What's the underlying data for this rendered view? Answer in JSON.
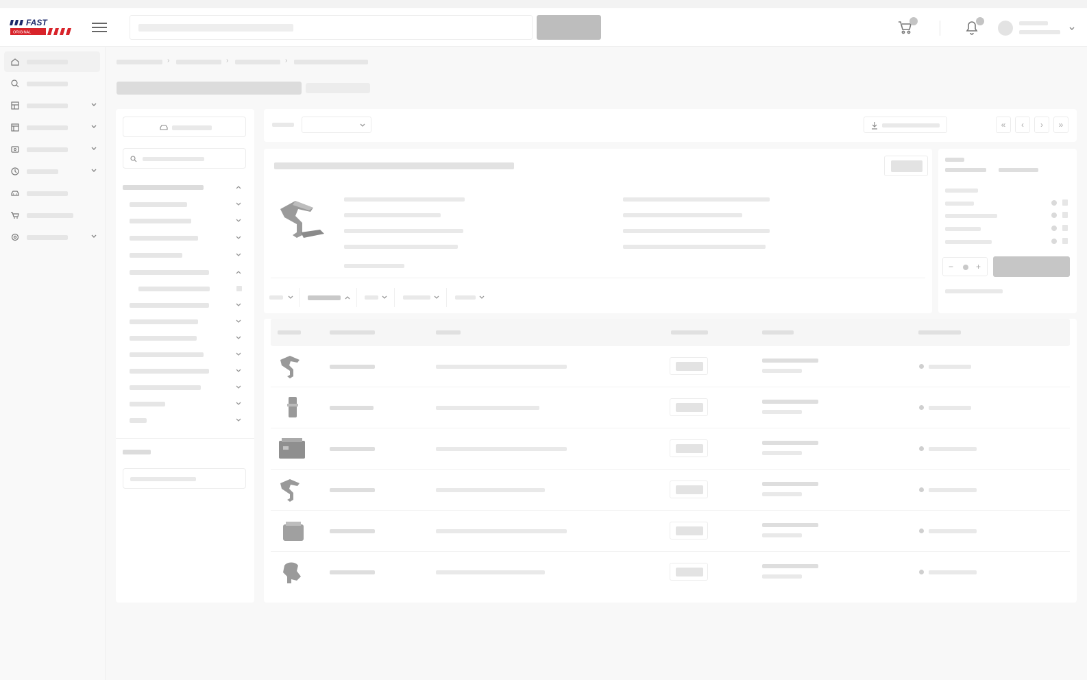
{
  "header": {
    "logo": {
      "wordmark": "FAST",
      "tagline": "ORIGINAL",
      "colors": {
        "blue": "#1d2a6b",
        "red": "#d8232a"
      }
    },
    "search_icon": "none",
    "icons": [
      "menu-icon",
      "cart-icon",
      "bell-icon",
      "avatar"
    ]
  },
  "sidebar": {
    "icons": [
      "home-icon",
      "search-icon",
      "catalog-icon",
      "calendar-icon",
      "wallet-icon",
      "history-icon",
      "vehicle-icon",
      "cart-icon",
      "settings-icon"
    ]
  },
  "toolbar": {
    "pagination_icons": [
      "first-page-icon",
      "prev-page-icon",
      "next-page-icon",
      "last-page-icon"
    ],
    "pagination_glyphs": [
      "«",
      "‹",
      "›",
      "»"
    ]
  },
  "side_card": {
    "qty_minus": "−",
    "qty_plus": "+"
  },
  "colors": {
    "skeleton": "#e8e8e8",
    "skeleton_dark": "#c4c4c4",
    "background": "#f8f8f8"
  }
}
